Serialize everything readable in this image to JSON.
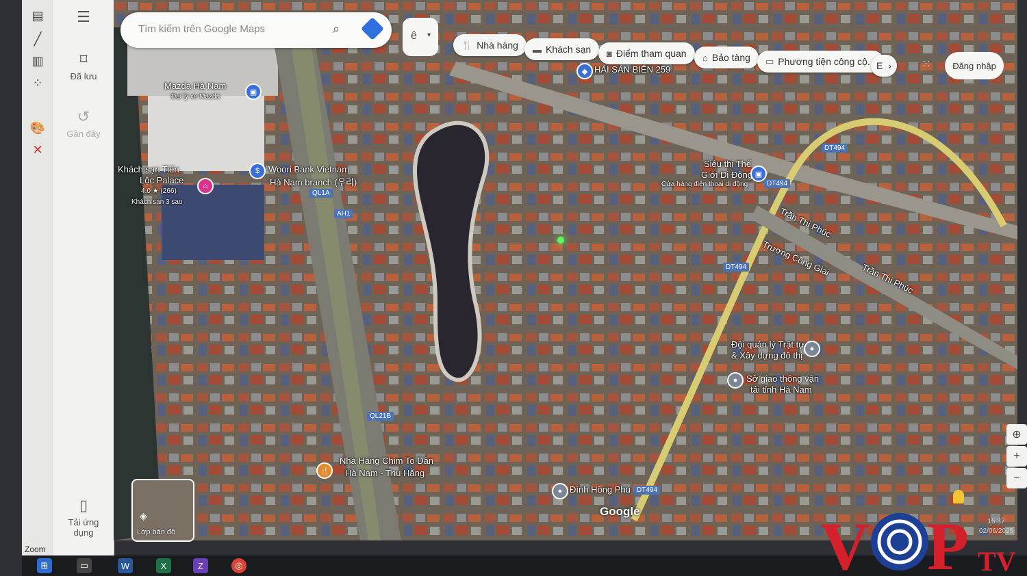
{
  "annotation_toolbar": {
    "zoom_label": "Zoom",
    "tools": [
      "page-icon",
      "pen-icon",
      "highlighter-icon",
      "pointer-icon",
      "palette-icon",
      "close-x-icon"
    ]
  },
  "rail": {
    "menu_icon": "menu-icon",
    "saved_label": "Đã lưu",
    "recent_label": "Gần đây",
    "apps_label_line1": "Tải ứng",
    "apps_label_line2": "dụng"
  },
  "search": {
    "placeholder": "Tìm kiếm trên Google Maps",
    "lang_value": "ê"
  },
  "chips": [
    {
      "icon": "fork-knife-icon",
      "label": "Nhà hàng"
    },
    {
      "icon": "bed-icon",
      "label": "Khách sạn"
    },
    {
      "icon": "camera-icon",
      "label": "Điểm tham quan"
    },
    {
      "icon": "museum-icon",
      "label": "Bảo tàng"
    },
    {
      "icon": "bus-icon",
      "label": "Phương tiện công cộ..."
    },
    {
      "icon": "more-icon",
      "label": "E"
    }
  ],
  "signin_label": "Đăng nhập",
  "map_labels": {
    "mazda": "Mazda Hà Nam",
    "mazda_sub": "Đại lý xe Mazda",
    "hotel": "Khách sạn Tiến",
    "hotel2": "Lộc Palace",
    "hotel_rating": "4.0 ★ (266)",
    "hotel_sub": "Khách sạn 3 sao",
    "woori": "Woori Bank Vietnam",
    "woori2": "Hà Nam branch (우리)",
    "haisan": "HẢI SẢN BIỂN 259",
    "sieuthi": "Siêu thị Thế",
    "sieuthi2": "Giới Di Động",
    "sieuthi3": "Cửa hàng điện thoại di động",
    "tranthiphuc1": "Trần Thị Phúc",
    "tranthiphuc2": "Trần Thị Phúc",
    "truongconggiai": "Trương Công Giai",
    "doiquanly": "Đội quản lý Trật tự",
    "doiquanly2": "& Xây dựng đô thị",
    "sogiaothong": "Sở giao thông vận",
    "sogiaothong2": "tải tỉnh Hà Nam",
    "nhahang": "Nhà Hàng Chim To Dân",
    "nhahang2": "Hà Nam - Thu Hằng",
    "dinh": "Đình Hồng Phú",
    "ql1a": "QL1A",
    "ah1": "AH1",
    "ql21b": "QL21B",
    "dt494a": "DT494",
    "dt494b": "DT494",
    "dt494c": "DT494",
    "dt494d": "DT494",
    "google": "Google",
    "layers": "Lớp bản đồ"
  },
  "clock": {
    "time": "15:37",
    "date": "02/06/2025"
  },
  "watermark": {
    "v": "V",
    "p": "P",
    "tv": "TV"
  },
  "colors": {
    "accent": "#2f6fdf",
    "logo_red": "#d4202a",
    "logo_blue": "#1d3f94"
  }
}
